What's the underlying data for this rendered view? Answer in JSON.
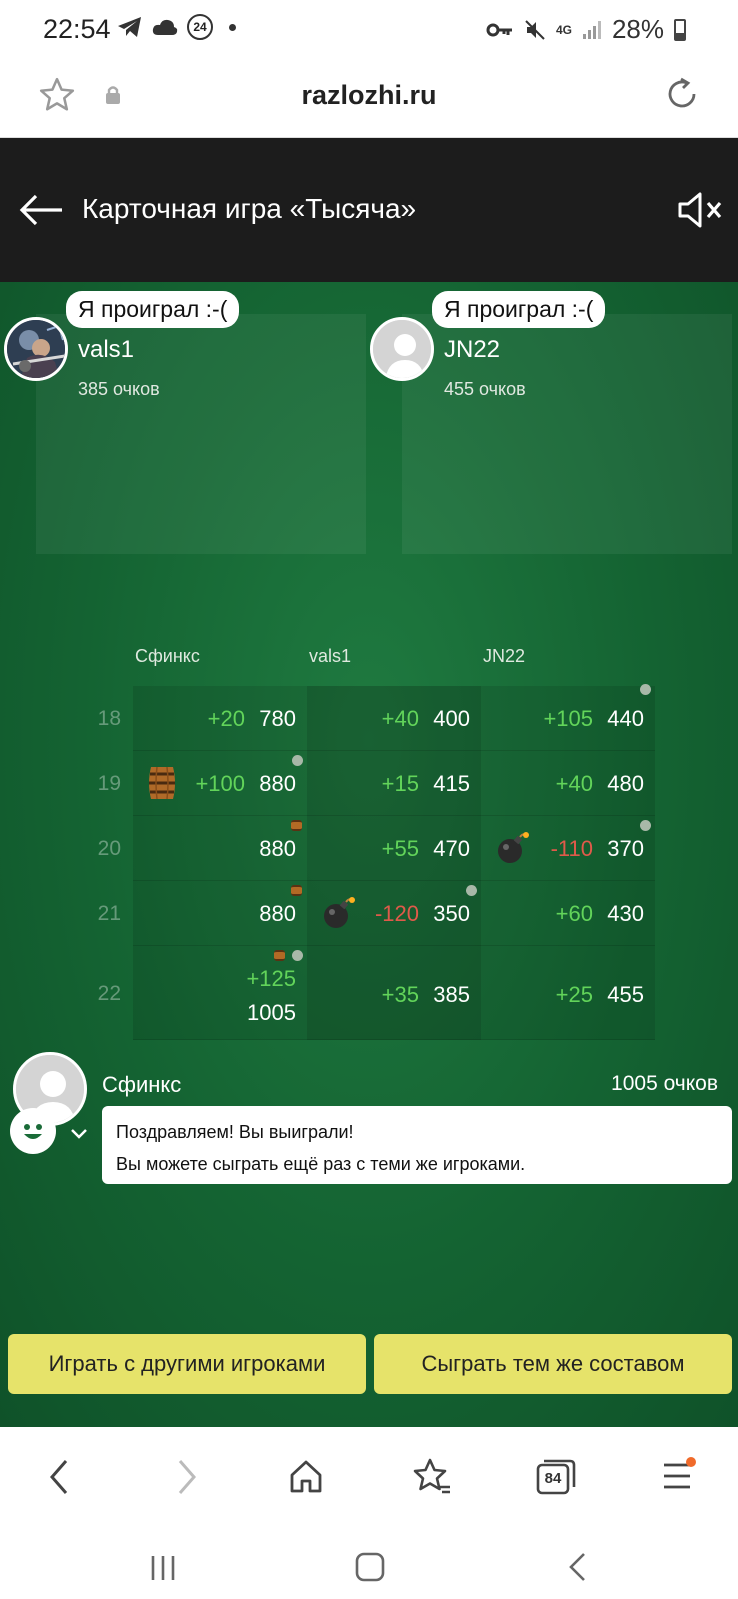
{
  "status_bar": {
    "time": "22:54",
    "badge": "24",
    "network": "4G",
    "battery": "28%"
  },
  "address_bar": {
    "url": "razlozhi.ru"
  },
  "header": {
    "title": "Карточная игра «Тысяча»"
  },
  "players": [
    {
      "name": "vals1",
      "score": "385 очков",
      "speech": "Я проиграл :-("
    },
    {
      "name": "JN22",
      "score": "455 очков",
      "speech": "Я проиграл :-("
    }
  ],
  "table": {
    "columns": [
      "Сфинкс",
      "vals1",
      "JN22"
    ],
    "rows": [
      {
        "num": "18",
        "cells": [
          {
            "delta": "+20",
            "total": "780"
          },
          {
            "delta": "+40",
            "total": "400"
          },
          {
            "delta": "+105",
            "total": "440"
          }
        ]
      },
      {
        "num": "19",
        "cells": [
          {
            "delta": "+100",
            "total": "880"
          },
          {
            "delta": "+15",
            "total": "415"
          },
          {
            "delta": "+40",
            "total": "480"
          }
        ]
      },
      {
        "num": "20",
        "cells": [
          {
            "delta": "",
            "total": "880"
          },
          {
            "delta": "+55",
            "total": "470"
          },
          {
            "delta": "-110",
            "total": "370"
          }
        ]
      },
      {
        "num": "21",
        "cells": [
          {
            "delta": "",
            "total": "880"
          },
          {
            "delta": "-120",
            "total": "350"
          },
          {
            "delta": "+60",
            "total": "430"
          }
        ]
      },
      {
        "num": "22",
        "cells": [
          {
            "delta": "+125",
            "total": "1005"
          },
          {
            "delta": "+35",
            "total": "385"
          },
          {
            "delta": "+25",
            "total": "455"
          }
        ]
      }
    ]
  },
  "winner": {
    "name": "Сфинкс",
    "score": "1005 очков",
    "message_line1": "Поздравляем! Вы выиграли!",
    "message_line2": "Вы можете сыграть ещё раз с теми же игроками."
  },
  "buttons": {
    "play_others": "Играть с другими игроками",
    "play_same": "Сыграть тем же составом"
  },
  "browser_nav": {
    "tabs_count": "84"
  },
  "colors": {
    "felt": "#146332",
    "button": "#e6e36a",
    "positive": "#62d45a",
    "negative": "#e05a4a"
  }
}
